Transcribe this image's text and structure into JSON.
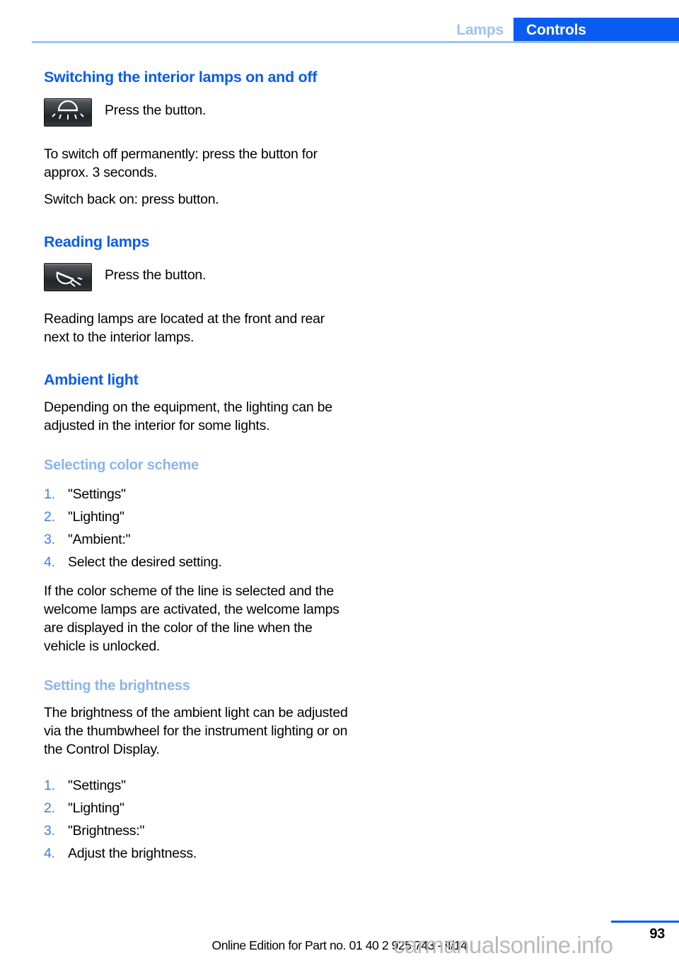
{
  "header": {
    "tab_inactive": "Lamps",
    "tab_active": "Controls",
    "accent_color": "#0a5bf0",
    "muted_accent_color": "#9dc2f5"
  },
  "sections": {
    "interior_lamps": {
      "title": "Switching the interior lamps on and off",
      "icon_name": "interior-dome-lamp-icon",
      "icon_caption": "Press the button.",
      "paragraph_1": "To switch off permanently: press the button for approx. 3 seconds.",
      "paragraph_2": "Switch back on: press button."
    },
    "reading_lamps": {
      "title": "Reading lamps",
      "icon_name": "reading-lamp-icon",
      "icon_caption": "Press the button.",
      "paragraph_1": "Reading lamps are located at the front and rear next to the interior lamps."
    },
    "ambient_light": {
      "title": "Ambient light",
      "paragraph_1": "Depending on the equipment, the lighting can be adjusted in the interior for some lights.",
      "color_scheme": {
        "subtitle": "Selecting color scheme",
        "steps": [
          {
            "num": "1.",
            "text": "\"Settings\""
          },
          {
            "num": "2.",
            "text": "\"Lighting\""
          },
          {
            "num": "3.",
            "text": "\"Ambient:\""
          },
          {
            "num": "4.",
            "text": "Select the desired setting."
          }
        ],
        "paragraph_after": "If the color scheme of the line is selected and the welcome lamps are activated, the welcome lamps are displayed in the color of the line when the vehicle is unlocked."
      },
      "brightness": {
        "subtitle": "Setting the brightness",
        "paragraph_1": "The brightness of the ambient light can be adjusted via the thumbwheel for the instrument lighting or on the Control Display.",
        "steps": [
          {
            "num": "1.",
            "text": "\"Settings\""
          },
          {
            "num": "2.",
            "text": "\"Lighting\""
          },
          {
            "num": "3.",
            "text": "\"Brightness:\""
          },
          {
            "num": "4.",
            "text": "Adjust the brightness."
          }
        ]
      }
    }
  },
  "footer": {
    "page_number": "93",
    "edition_text": "Online Edition for Part no. 01 40 2 925 743 - II/14",
    "watermark": "carmanualsonline.info"
  }
}
